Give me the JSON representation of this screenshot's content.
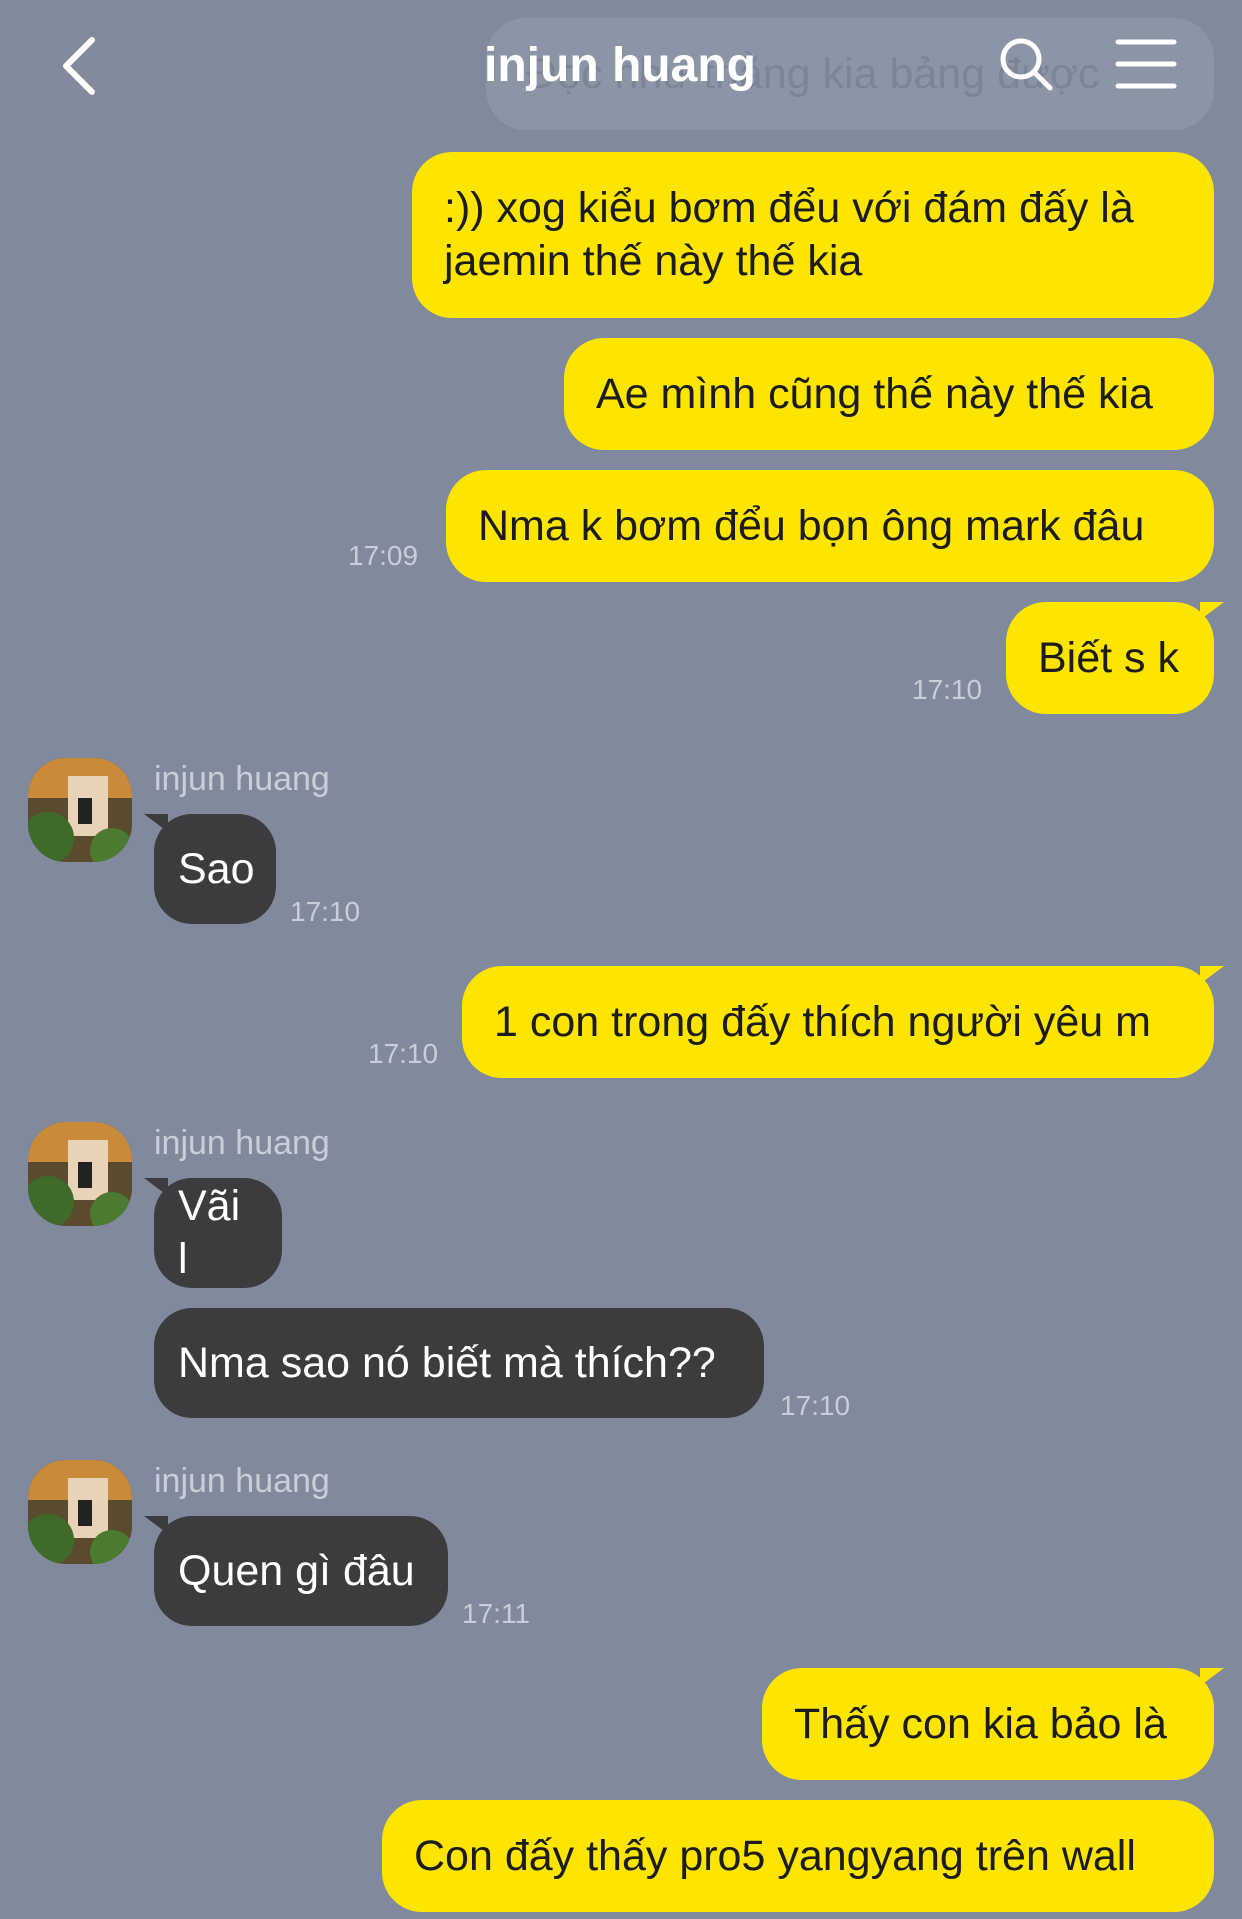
{
  "header": {
    "title": "injun huang",
    "back_icon": "chevron-left-icon",
    "search_icon": "search-icon",
    "menu_icon": "hamburger-menu-icon"
  },
  "colors": {
    "background": "#808a9c",
    "outgoing_bubble": "#fee500",
    "incoming_bubble": "#3c3c3e"
  },
  "ghost_message": "Đọc như thằng kia bảng được",
  "messages": [
    {
      "text": ":)) xog kiểu bơm đểu với đám đấy là jaemin thế này thế kia"
    },
    {
      "text": "Ae mình cũng thế này thế kia"
    },
    {
      "text": "Nma k bơm đểu bọn ông mark đâu",
      "time": "17:09"
    },
    {
      "text": "Biết s k",
      "time": "17:10"
    },
    {
      "sender": "injun huang",
      "text": "Sao",
      "time": "17:10"
    },
    {
      "text": "1 con trong đấy thích người yêu m",
      "time": "17:10"
    },
    {
      "sender": "injun huang",
      "text": "Vãi l"
    },
    {
      "text": "Nma sao nó biết mà thích??",
      "time": "17:10"
    },
    {
      "sender": "injun huang",
      "text": "Quen gì đâu",
      "time": "17:11"
    },
    {
      "text": "Thấy con kia bảo là"
    },
    {
      "text": "Con đấy thấy pro5 yangyang trên wall"
    }
  ]
}
